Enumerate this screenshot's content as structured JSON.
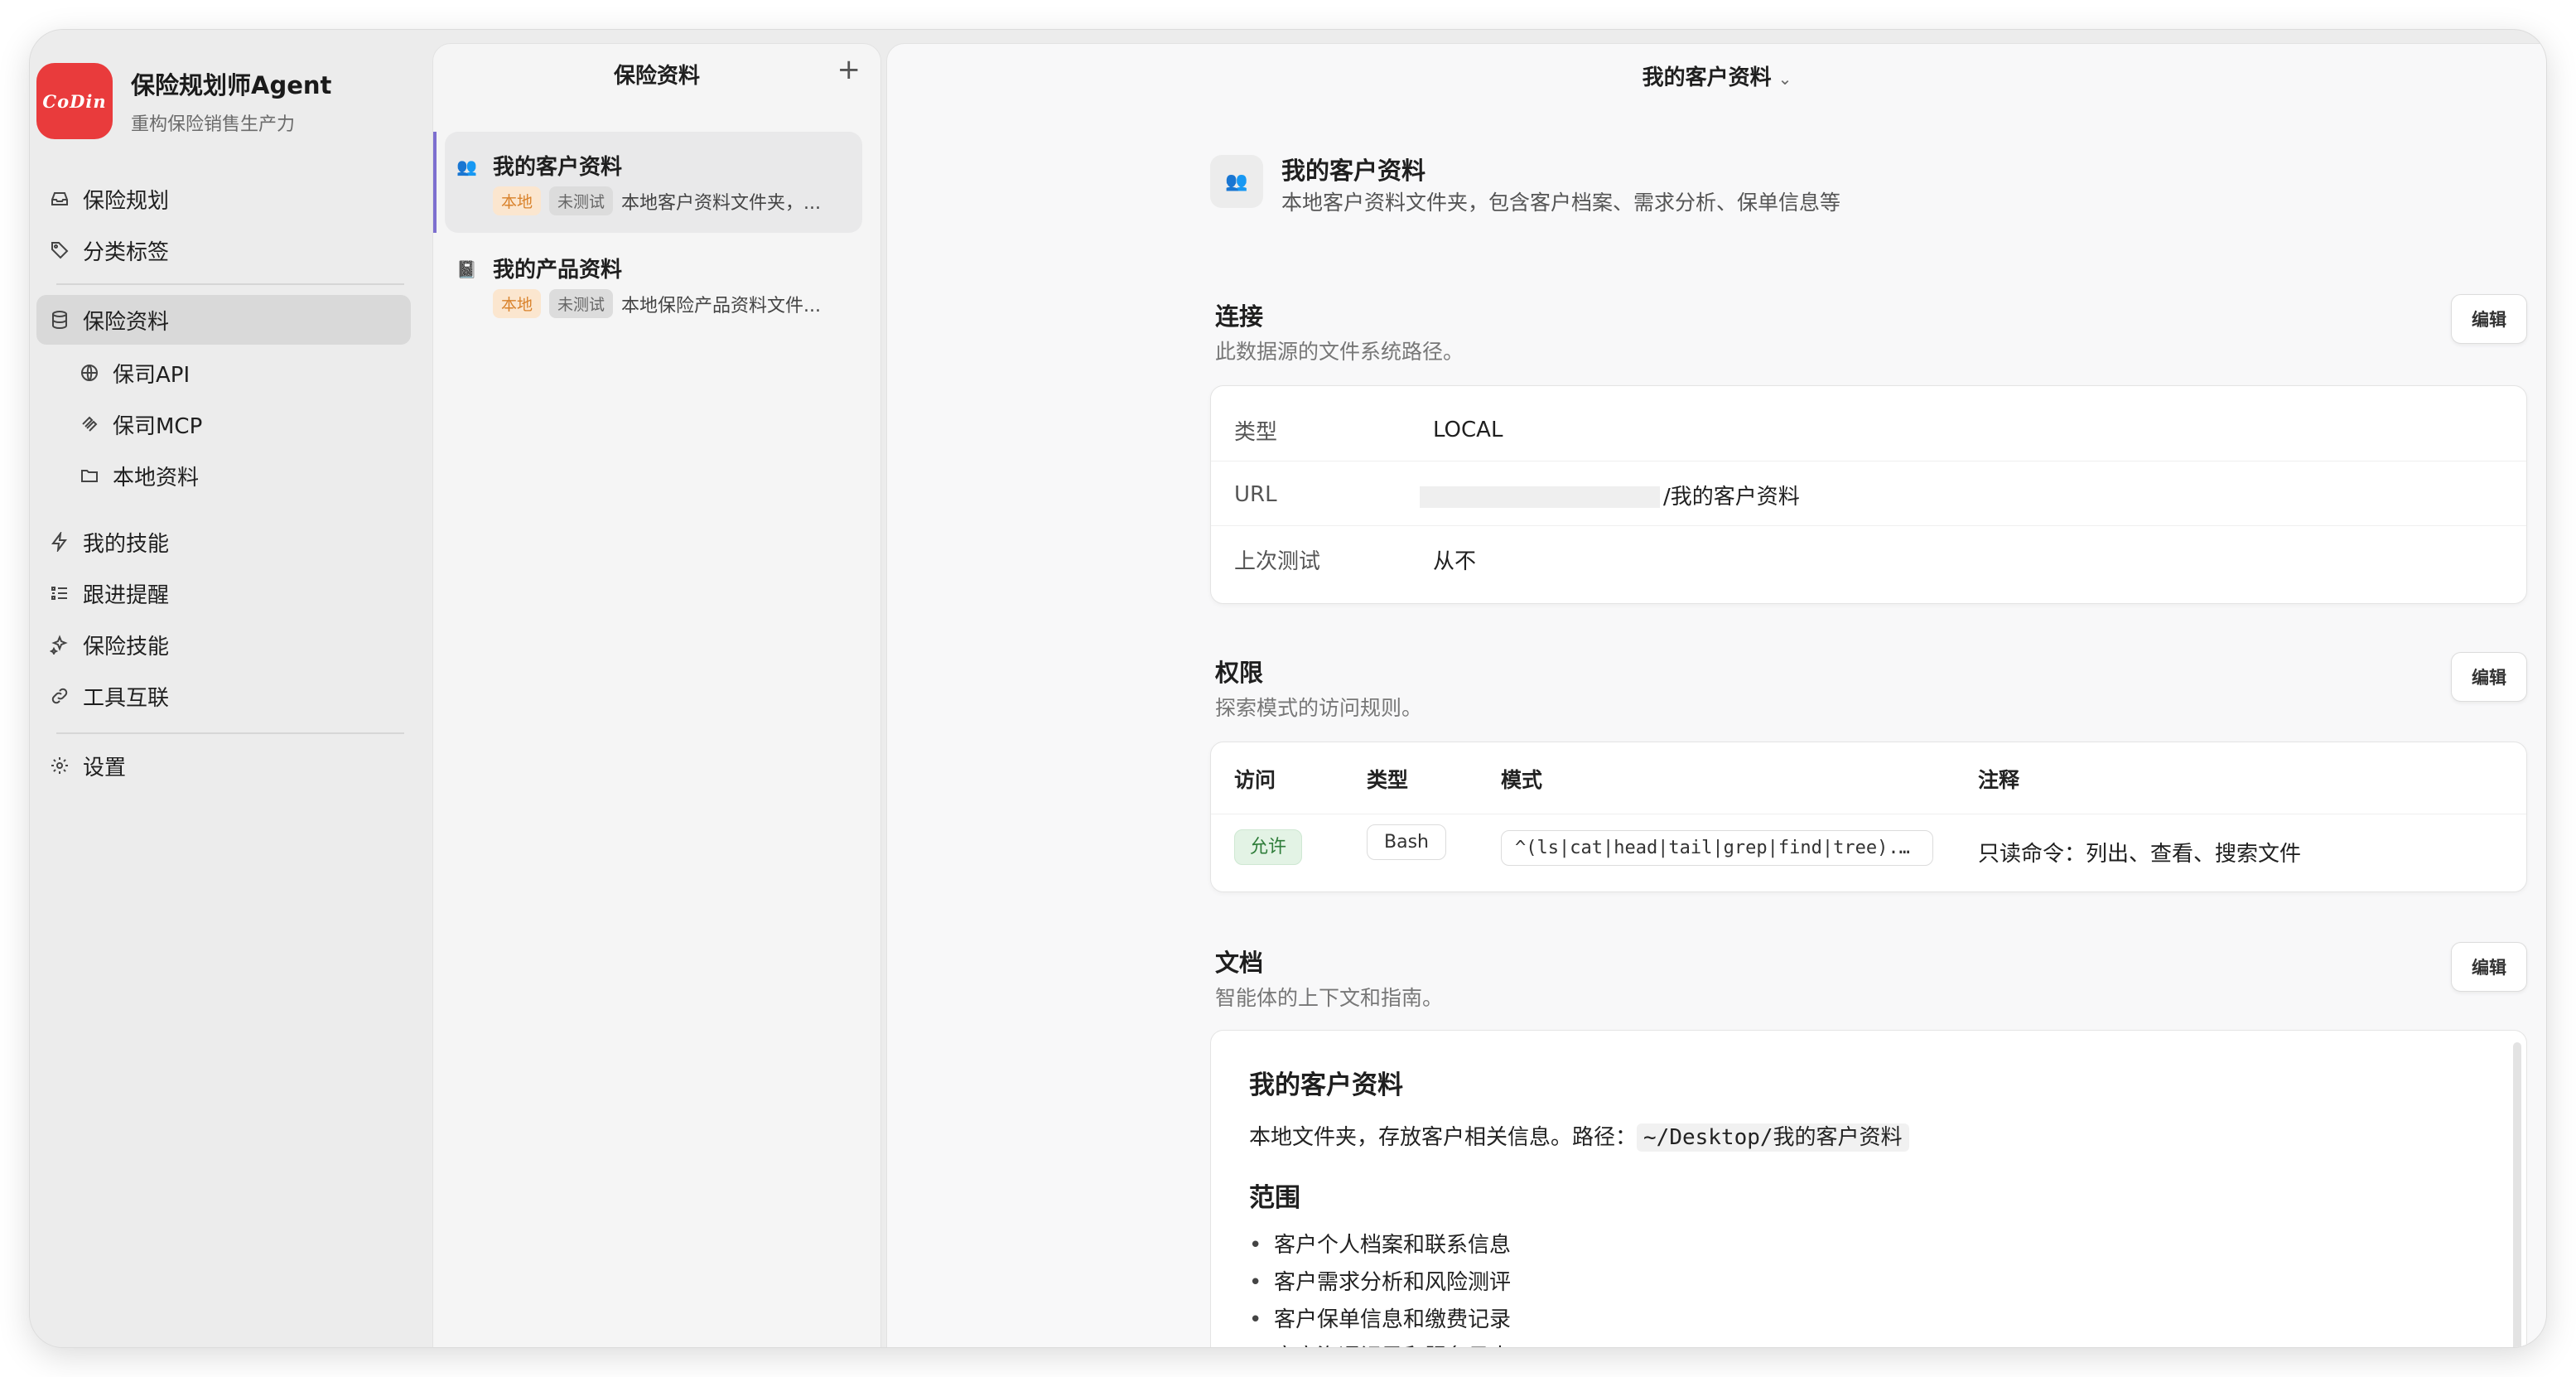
{
  "app": {
    "name": "保险规划师Agent",
    "subtitle": "重构保险销售生产力",
    "logo_text": "CoDin",
    "brand_color": "#e93b3c"
  },
  "sidebar": {
    "items": [
      {
        "label": "保险规划",
        "icon": "inbox-icon"
      },
      {
        "label": "分类标签",
        "icon": "tag-icon"
      },
      {
        "label": "保险资料",
        "icon": "database-icon",
        "active": true
      },
      {
        "label": "保司API",
        "icon": "globe-icon"
      },
      {
        "label": "保司MCP",
        "icon": "mcp-icon"
      },
      {
        "label": "本地资料",
        "icon": "folder-icon"
      },
      {
        "label": "我的技能",
        "icon": "bolt-icon"
      },
      {
        "label": "跟进提醒",
        "icon": "checklist-icon"
      },
      {
        "label": "保险技能",
        "icon": "sparkle-icon"
      },
      {
        "label": "工具互联",
        "icon": "link-icon"
      },
      {
        "label": "设置",
        "icon": "gear-icon"
      }
    ]
  },
  "middle": {
    "title": "保险资料",
    "add_label": "+",
    "sources": [
      {
        "name": "我的客户资料",
        "icon": "👥",
        "tag_local": "本地",
        "tag_status": "未测试",
        "desc": "本地客户资料文件夹，...",
        "active": true
      },
      {
        "name": "我的产品资料",
        "icon": "📓",
        "tag_local": "本地",
        "tag_status": "未测试",
        "desc": "本地保险产品资料文件..."
      }
    ]
  },
  "main": {
    "title": "我的客户资料",
    "header": {
      "icon": "👥",
      "name": "我的客户资料",
      "desc": "本地客户资料文件夹，包含客户档案、需求分析、保单信息等"
    },
    "edit_label": "编辑",
    "connection": {
      "title": "连接",
      "subtitle": "此数据源的文件系统路径。",
      "rows": [
        {
          "key": "类型",
          "value": "LOCAL"
        },
        {
          "key": "URL",
          "value": "/我的客户资料"
        },
        {
          "key": "上次测试",
          "value": "从不"
        }
      ]
    },
    "permissions": {
      "title": "权限",
      "subtitle": "探索模式的访问规则。",
      "headers": [
        "访问",
        "类型",
        "模式",
        "注释"
      ],
      "rows": [
        {
          "access": "允许",
          "type": "Bash",
          "pattern": "^(ls|cat|head|tail|grep|find|tree)...",
          "note": "只读命令：列出、查看、搜索文件"
        }
      ]
    },
    "docs": {
      "title": "文档",
      "subtitle": "智能体的上下文和指南。",
      "h1": "我的客户资料",
      "para_prefix": "本地文件夹，存放客户相关信息。路径：",
      "para_code": "~/Desktop/我的客户资料",
      "h2": "范围",
      "list": [
        "客户个人档案和联系信息",
        "客户需求分析和风险测评",
        "客户保单信息和缴费记录",
        "客户沟通记录和服务日志"
      ]
    }
  }
}
